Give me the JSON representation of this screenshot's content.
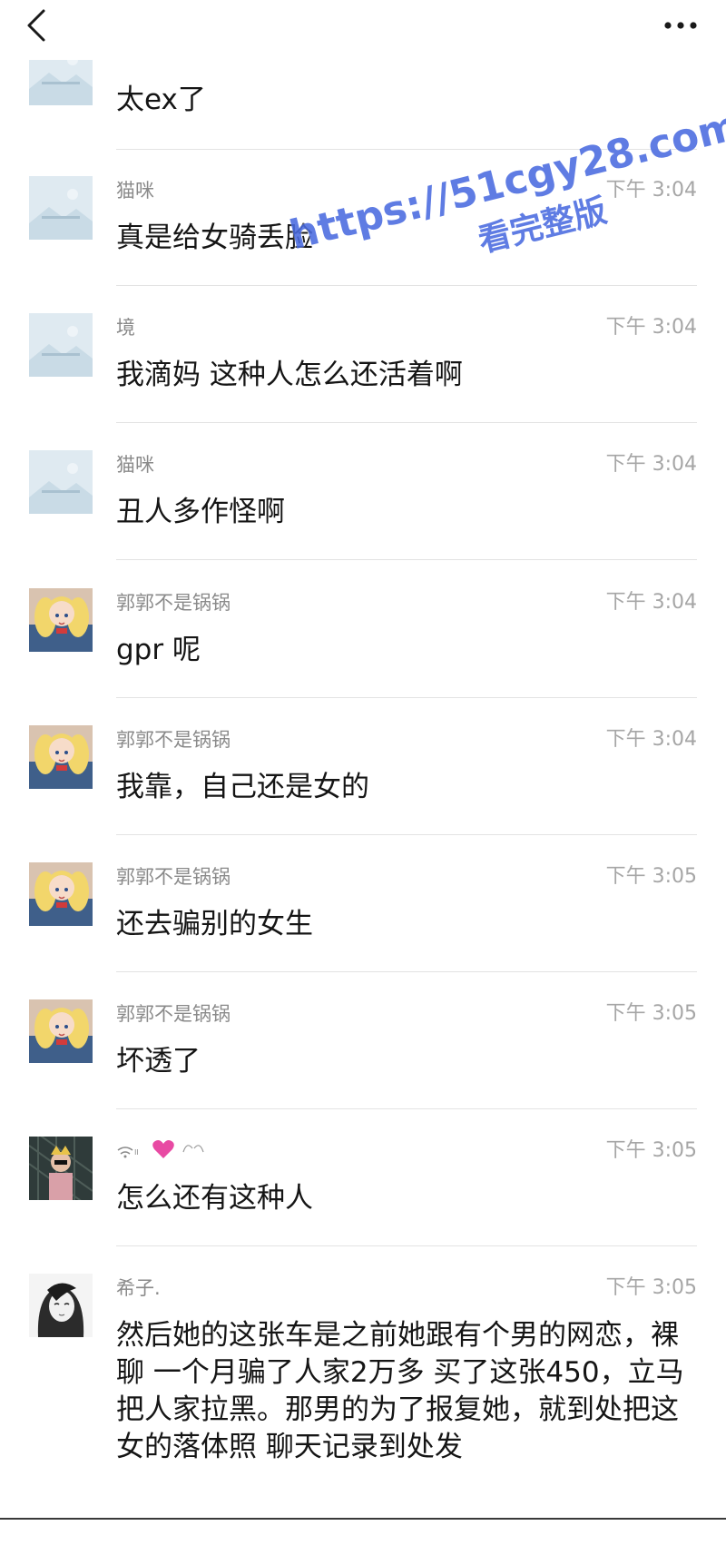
{
  "header": {
    "back_icon": "chevron-left-icon",
    "more_icon": "ellipsis-icon"
  },
  "messages": [
    {
      "name": "",
      "time": "",
      "text": "太ex了",
      "avatar": "placeholder-image"
    },
    {
      "name": "猫咪",
      "time": "下午 3:04",
      "text": "真是给女骑丢脸",
      "avatar": "placeholder-image"
    },
    {
      "name": "境",
      "time": "下午 3:04",
      "text": "我滴妈 这种人怎么还活着啊",
      "avatar": "placeholder-image"
    },
    {
      "name": "猫咪",
      "time": "下午 3:04",
      "text": "丑人多作怪啊",
      "avatar": "placeholder-image"
    },
    {
      "name": "郭郭不是锅锅",
      "time": "下午 3:04",
      "text": "gpr 呢",
      "avatar": "anime-girl"
    },
    {
      "name": "郭郭不是锅锅",
      "time": "下午 3:04",
      "text": "我靠，自己还是女的",
      "avatar": "anime-girl"
    },
    {
      "name": "郭郭不是锅锅",
      "time": "下午 3:05",
      "text": "还去骗别的女生",
      "avatar": "anime-girl"
    },
    {
      "name": "郭郭不是锅锅",
      "time": "下午 3:05",
      "text": "坏透了",
      "avatar": "anime-girl"
    },
    {
      "name": "ₗₗ",
      "time": "下午 3:05",
      "text": "怎么还有这种人",
      "avatar": "dark-photo"
    },
    {
      "name": "希子.",
      "time": "下午 3:05",
      "text": "然后她的这张车是之前她跟有个男的网恋，裸聊 一个月骗了人家2万多 买了这张450，立马把人家拉黑。那男的为了报复她，就到处把这女的落体照 聊天记录到处发",
      "avatar": "sketch-girl"
    }
  ],
  "watermark": {
    "line1": "https://51cgy28.com",
    "line2": "看完整版"
  }
}
